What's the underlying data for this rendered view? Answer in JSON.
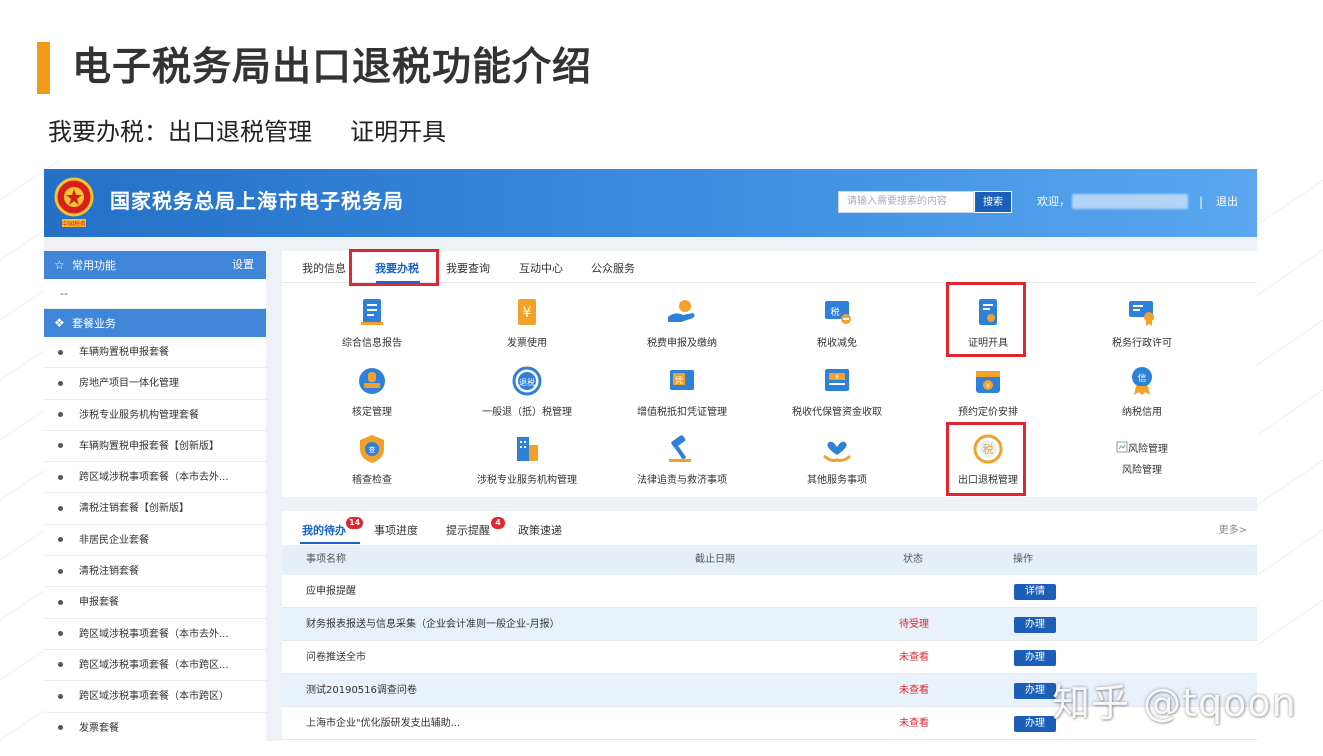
{
  "slide": {
    "title": "电子税务局出口退税功能介绍",
    "subtitle": "我要办税：出口退税管理     证明开具",
    "accent_color": "#f39a1b"
  },
  "header": {
    "site_title": "国家税务总局上海市电子税务局",
    "search_placeholder": "请输入需要搜索的内容",
    "search_button": "搜索",
    "welcome": "欢迎，",
    "separator": "|",
    "logout": "退出",
    "brand_color": "#2470c6"
  },
  "sidebar": {
    "common": {
      "label": "常用功能",
      "settings": "设置",
      "icon": "star-icon"
    },
    "common_placeholder": "--",
    "package": {
      "label": "套餐业务",
      "icon": "layers-icon"
    },
    "items": [
      "车辆购置税申报套餐",
      "房地产项目一体化管理",
      "涉税专业服务机构管理套餐",
      "车辆购置税申报套餐【创新版】",
      "跨区域涉税事项套餐（本市去外...",
      "清税注销套餐【创新版】",
      "非居民企业套餐",
      "清税注销套餐",
      "申报套餐",
      "跨区域涉税事项套餐（本市去外...",
      "跨区域涉税事项套餐（本市跨区...",
      "跨区域涉税事项套餐（本市跨区）",
      "发票套餐"
    ]
  },
  "tabs": [
    "我的信息",
    "我要办税",
    "我要查询",
    "互动中心",
    "公众服务"
  ],
  "active_tab": "我要办税",
  "functions": [
    {
      "label": "综合信息报告",
      "icon": "report-icon"
    },
    {
      "label": "发票使用",
      "icon": "invoice-icon"
    },
    {
      "label": "税费申报及缴纳",
      "icon": "tax-payment-icon"
    },
    {
      "label": "税收减免",
      "icon": "tax-reduction-icon"
    },
    {
      "label": "证明开具",
      "icon": "certificate-icon"
    },
    {
      "label": "税务行政许可",
      "icon": "permit-icon"
    },
    {
      "label": "核定管理",
      "icon": "stamp-icon"
    },
    {
      "label": "一般退（抵）税管理",
      "icon": "refund-icon"
    },
    {
      "label": "增值税抵扣凭证管理",
      "icon": "voucher-icon"
    },
    {
      "label": "税收代保管资金收取",
      "icon": "custody-fund-icon"
    },
    {
      "label": "预约定价安排",
      "icon": "calendar-icon"
    },
    {
      "label": "纳税信用",
      "icon": "credit-icon"
    },
    {
      "label": "稽查检查",
      "icon": "shield-icon"
    },
    {
      "label": "涉税专业服务机构管理",
      "icon": "building-icon"
    },
    {
      "label": "法律追责与救济事项",
      "icon": "gavel-icon"
    },
    {
      "label": "其他服务事项",
      "icon": "heart-hand-icon"
    },
    {
      "label": "出口退税管理",
      "icon": "export-refund-icon"
    },
    {
      "label": "风险管理",
      "icon": "broken-image-icon",
      "alt": "风险管理"
    }
  ],
  "bottom_tabs": [
    {
      "label": "我的待办",
      "badge": "14"
    },
    {
      "label": "事项进度",
      "badge": ""
    },
    {
      "label": "提示提醒",
      "badge": "4"
    },
    {
      "label": "政策速递",
      "badge": ""
    }
  ],
  "more": "更多>",
  "table": {
    "headers": [
      "事项名称",
      "截止日期",
      "状态",
      "操作"
    ],
    "rows": [
      {
        "name": "应申报提醒",
        "deadline": "",
        "status": "",
        "action": "详情"
      },
      {
        "name": "财务报表报送与信息采集（企业会计准则一般企业-月报）",
        "deadline": "",
        "status": "待受理",
        "action": "办理"
      },
      {
        "name": "问卷推送全市",
        "deadline": "",
        "status": "未查看",
        "action": "办理"
      },
      {
        "name": "测试20190516调查问卷",
        "deadline": "",
        "status": "未查看",
        "action": "办理"
      },
      {
        "name": "上海市企业\"优化版研发支出辅助...",
        "deadline": "",
        "status": "未查看",
        "action": "办理"
      }
    ]
  },
  "watermark": "知乎 @tqoon"
}
